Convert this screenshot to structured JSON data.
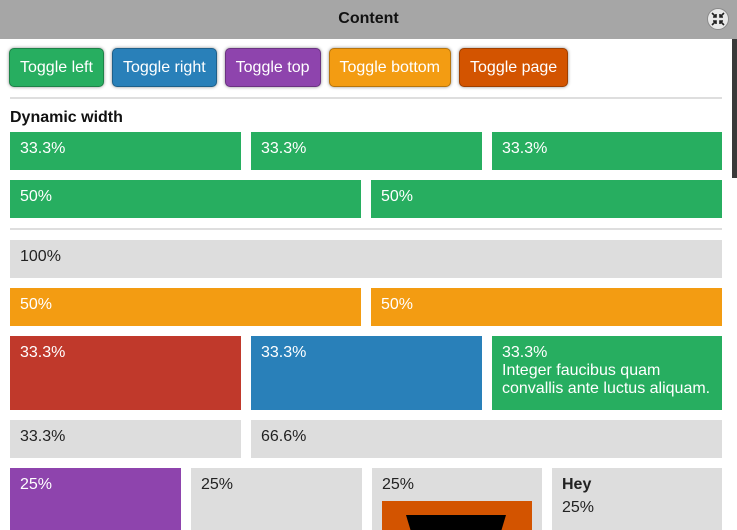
{
  "window": {
    "title": "Content",
    "close_icon": "collapse-arrows-icon"
  },
  "toolbar": {
    "buttons": [
      {
        "label": "Toggle left",
        "color": "#27ae60"
      },
      {
        "label": "Toggle right",
        "color": "#2980b9"
      },
      {
        "label": "Toggle top",
        "color": "#8e44ad"
      },
      {
        "label": "Toggle bottom",
        "color": "#f39c12"
      },
      {
        "label": "Toggle page",
        "color": "#d35400"
      }
    ]
  },
  "dynamic_width": {
    "title": "Dynamic width",
    "row1": [
      "33.3%",
      "33.3%",
      "33.3%"
    ],
    "row2": [
      "50%",
      "50%"
    ]
  },
  "grid": {
    "full": "100%",
    "halves": [
      "50%",
      "50%"
    ],
    "thirds": [
      {
        "label": "33.3%",
        "text": ""
      },
      {
        "label": "33.3%",
        "text": ""
      },
      {
        "label": "33.3%",
        "text": "Integer faucibus quam convallis ante luctus aliquam."
      }
    ],
    "third_twothirds": [
      "33.3%",
      "66.6%"
    ],
    "quarters": [
      {
        "label": "25%",
        "heading": ""
      },
      {
        "label": "25%",
        "heading": ""
      },
      {
        "label": "25%",
        "heading": ""
      },
      {
        "label": "25%",
        "heading": "Hey"
      }
    ]
  },
  "colors": {
    "green": "#27ae60",
    "blue": "#2980b9",
    "purple": "#8e44ad",
    "orange": "#f39c12",
    "dark_orange": "#d35400",
    "red": "#c0392b",
    "grey": "#dddddd",
    "titlebar": "#a6a6a6"
  }
}
